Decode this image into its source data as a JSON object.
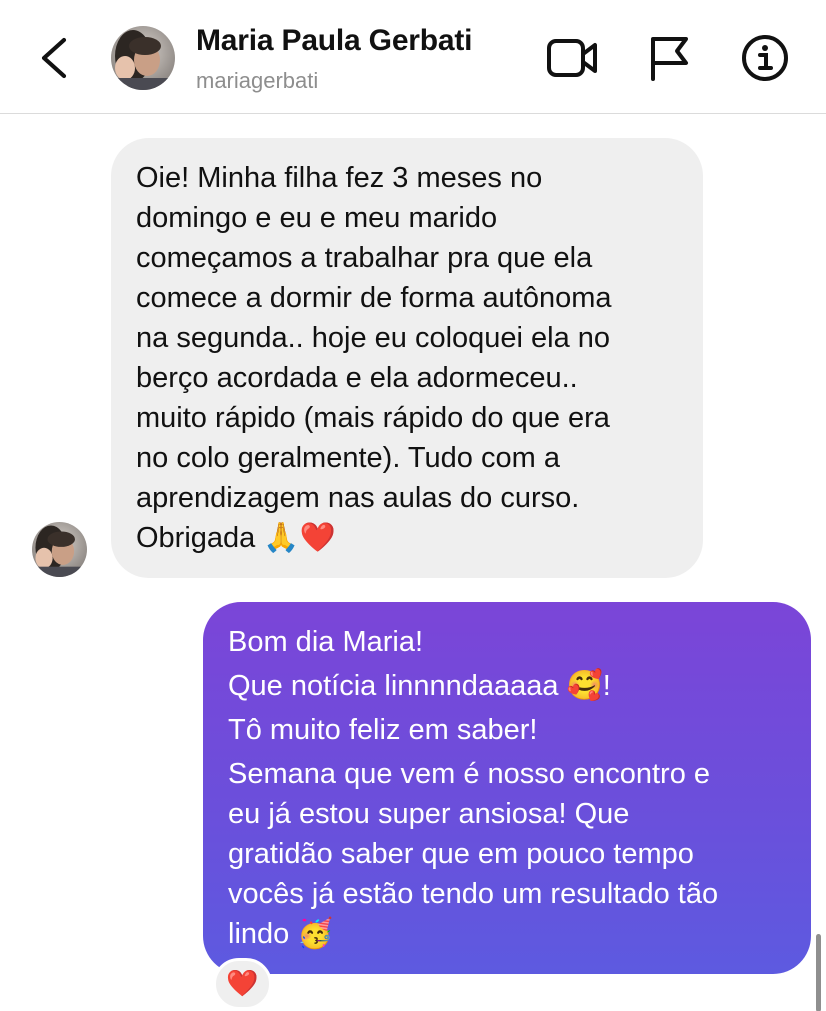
{
  "header": {
    "name": "Maria Paula Gerbati",
    "username": "mariagerbati"
  },
  "incoming": {
    "lines": [
      "Oie! Minha filha fez 3 meses no",
      "domingo e eu e meu marido",
      "começamos a trabalhar pra que ela",
      "comece a dormir de forma autônoma",
      "na segunda.. hoje eu coloquei ela no",
      "berço acordada e ela adormeceu..",
      "muito rápido (mais rápido do que era",
      "no colo geralmente). Tudo com a",
      "aprendizagem nas aulas do curso.",
      "Obrigada 🙏❤️"
    ]
  },
  "outgoing": {
    "lines": [
      "Bom dia Maria!",
      "Que notícia linnnndaaaaa 🥰!",
      "Tô muito feliz em saber!",
      "Semana que vem é nosso encontro e",
      "eu já estou super ansiosa! Que",
      "gratidão saber que em pouco tempo",
      "vocês já estão tendo um resultado tão",
      "lindo 🥳"
    ],
    "gradient_top": "#7b45d8",
    "gradient_bottom": "#5d5ae0"
  },
  "reaction": {
    "emoji": "❤️"
  },
  "colors": {
    "incoming_bubble": "#efefef",
    "username": "#8e8e8e",
    "divider": "#dbdbdb"
  },
  "icons": [
    "back-arrow-icon",
    "video-call-icon",
    "flag-icon",
    "info-icon",
    "heart-icon"
  ]
}
